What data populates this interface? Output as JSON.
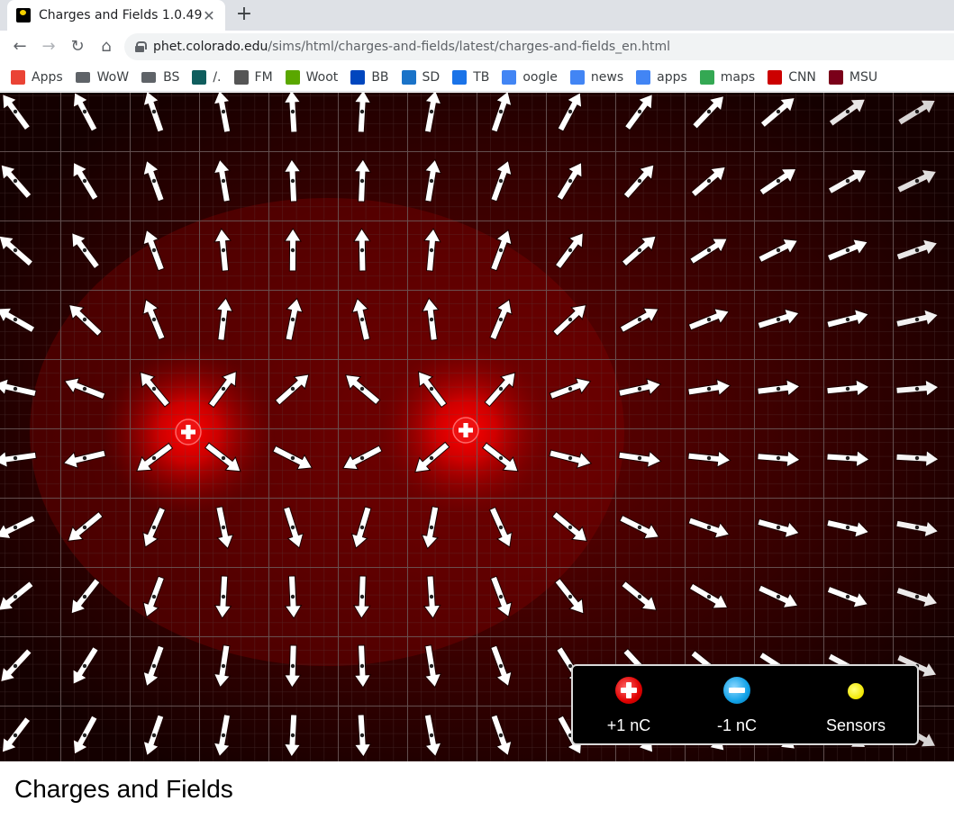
{
  "browser": {
    "tab_title": "Charges and Fields 1.0.49",
    "tab_close": "✕",
    "new_tab": "+",
    "url_host": "phet.colorado.edu",
    "url_path": "/sims/html/charges-and-fields/latest/charges-and-fields_en.html",
    "nav": {
      "back": "←",
      "forward": "→",
      "reload": "↻",
      "home": "⌂"
    }
  },
  "bookmarks": [
    {
      "label": "Apps",
      "icon": "apps-grid-icon",
      "color": "#ea4335"
    },
    {
      "label": "WoW",
      "icon": "folder-icon",
      "color": "#5f6368"
    },
    {
      "label": "BS",
      "icon": "folder-icon",
      "color": "#5f6368"
    },
    {
      "label": "/.",
      "icon": "slashdot-icon",
      "color": "#0f5d5d"
    },
    {
      "label": "FM",
      "icon": "fm-icon",
      "color": "#555555"
    },
    {
      "label": "Woot",
      "icon": "woot-icon",
      "color": "#5aa700"
    },
    {
      "label": "BB",
      "icon": "bestbuy-icon",
      "color": "#0046be"
    },
    {
      "label": "SD",
      "icon": "sd-icon",
      "color": "#1a73c8"
    },
    {
      "label": "TB",
      "icon": "tb-icon",
      "color": "#1a73e8"
    },
    {
      "label": "oogle",
      "icon": "google-icon",
      "color": "#4285f4"
    },
    {
      "label": "news",
      "icon": "google-news-icon",
      "color": "#4285f4"
    },
    {
      "label": "apps",
      "icon": "google-icon",
      "color": "#4285f4"
    },
    {
      "label": "maps",
      "icon": "maps-pin-icon",
      "color": "#34a853"
    },
    {
      "label": "CNN",
      "icon": "cnn-icon",
      "color": "#cc0000"
    },
    {
      "label": "MSU",
      "icon": "msu-icon",
      "color": "#7a0019"
    }
  ],
  "simulation": {
    "background_color": "#000000",
    "glow_color": "#ff0000",
    "charges": [
      {
        "sign": "+",
        "type": "positive"
      },
      {
        "sign": "+",
        "type": "positive"
      }
    ],
    "toolbox": {
      "positive_label": "+1 nC",
      "negative_label": "-1 nC",
      "sensors_label": "Sensors"
    }
  },
  "page": {
    "heading": "Charges and Fields"
  }
}
